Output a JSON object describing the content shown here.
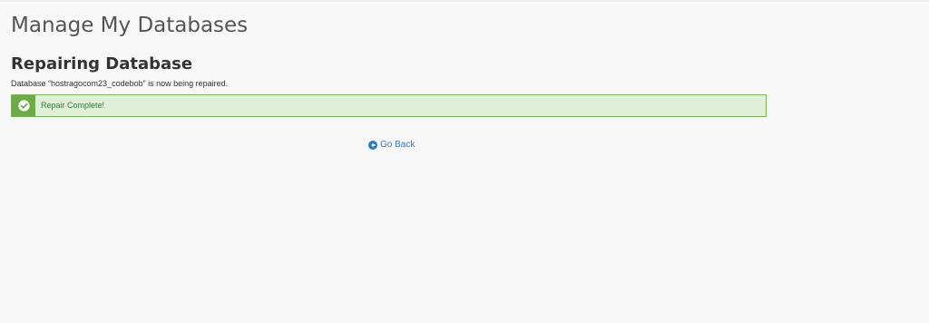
{
  "page": {
    "title": "Manage My Databases"
  },
  "section": {
    "title": "Repairing Database",
    "message": "Database “hostragocom23_codebob” is now being repaired."
  },
  "alert": {
    "icon": "check-circle-icon",
    "text": "Repair Complete!",
    "colors": {
      "background": "#dff0d8",
      "border": "#7cb15b",
      "icon_background": "#6fab49",
      "text": "#3c763d"
    }
  },
  "navigation": {
    "back_icon": "arrow-circle-left-icon",
    "back_label": "Go Back",
    "link_color": "#2d7ab8"
  }
}
